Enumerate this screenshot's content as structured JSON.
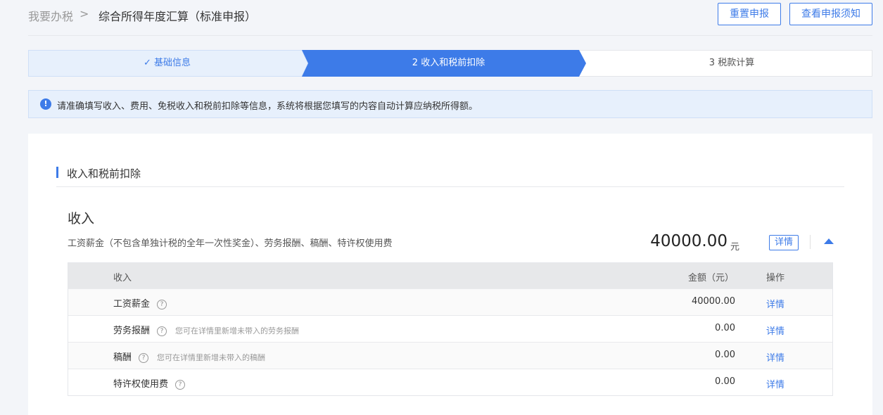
{
  "breadcrumb": {
    "root": "我要办税",
    "separator": ">",
    "current": "综合所得年度汇算（标准申报）"
  },
  "header_buttons": {
    "reset": "重置申报",
    "notice": "查看申报须知"
  },
  "steps": [
    {
      "label": "✓ 基础信息",
      "state": "done"
    },
    {
      "label": "2 收入和税前扣除",
      "state": "active"
    },
    {
      "label": "3 税款计算",
      "state": "pending"
    }
  ],
  "notice": {
    "icon": "!",
    "text": "请准确填写收入、费用、免税收入和税前扣除等信息，系统将根据您填写的内容自动计算应纳税所得额。"
  },
  "section": {
    "title": "收入和税前扣除"
  },
  "income": {
    "heading": "收入",
    "description": "工资薪金（不包含单独计税的全年一次性奖金）、劳务报酬、稿酬、特许权使用费",
    "total": "40000.00",
    "unit": "元",
    "detail_label": "详情"
  },
  "table": {
    "headers": {
      "name": "收入",
      "amount": "金额（元）",
      "op": "操作"
    },
    "rows": [
      {
        "name": "工资薪金",
        "hint": "",
        "amount": "40000.00",
        "op": "详情"
      },
      {
        "name": "劳务报酬",
        "hint": "您可在详情里新增未带入的劳务报酬",
        "amount": "0.00",
        "op": "详情"
      },
      {
        "name": "稿酬",
        "hint": "您可在详情里新增未带入的稿酬",
        "amount": "0.00",
        "op": "详情"
      },
      {
        "name": "特许权使用费",
        "hint": "",
        "amount": "0.00",
        "op": "详情"
      }
    ]
  },
  "colors": {
    "accent": "#3d7be8",
    "step_done_bg": "#e7f0fc",
    "step_active_bg": "#3d7be8"
  },
  "icons": {
    "help": "?"
  }
}
